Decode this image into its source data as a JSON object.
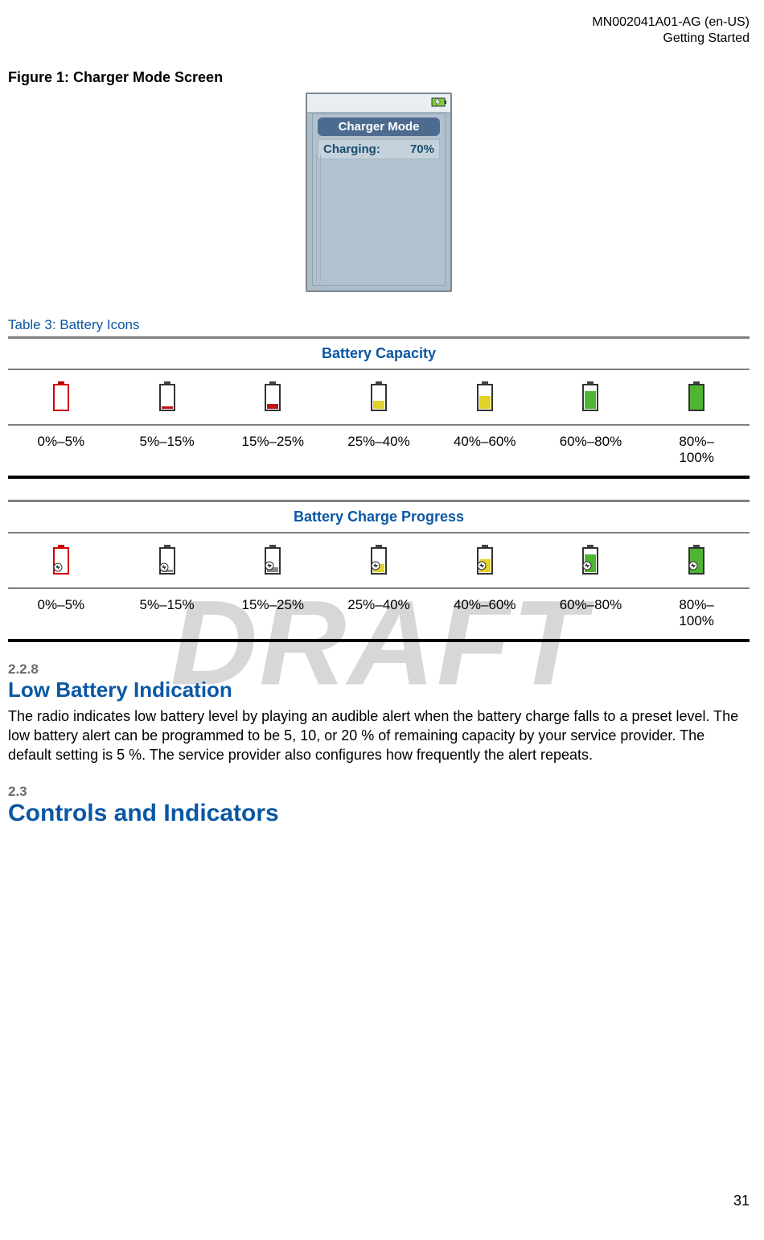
{
  "header": {
    "doc_id": "MN002041A01-AG (en-US)",
    "section": "Getting Started"
  },
  "figure": {
    "caption": "Figure 1: Charger Mode Screen",
    "phone_title": "Charger Mode",
    "phone_row_label": "Charging:",
    "phone_row_value": "70%"
  },
  "table3": {
    "caption": "Table 3: Battery Icons",
    "t1_title": "Battery Capacity",
    "t2_title": "Battery Charge Progress",
    "ranges": [
      "0%–5%",
      "5%–15%",
      "15%–25%",
      "25%–40%",
      "40%–60%",
      "60%–80%",
      "80%–\n100%"
    ]
  },
  "sec228": {
    "num": "2.2.8",
    "title": "Low Battery Indication",
    "body": "The radio indicates low battery level by playing an audible alert when the battery charge falls to a preset level. The low battery alert can be programmed to be 5, 10, or 20 % of remaining capacity by your service provider. The default setting is 5 %. The service provider also configures how frequently the alert repeats."
  },
  "sec23": {
    "num": "2.3",
    "title": "Controls and Indicators"
  },
  "watermark": "DRAFT",
  "page_number": "31",
  "chart_data": [
    {
      "type": "table",
      "title": "Battery Capacity",
      "categories": [
        "0%–5%",
        "5%–15%",
        "15%–25%",
        "25%–40%",
        "40%–60%",
        "60%–80%",
        "80%–100%"
      ],
      "series": [
        {
          "name": "fill_color",
          "values": [
            "none",
            "red",
            "red",
            "yellow",
            "yellow",
            "green",
            "green"
          ]
        },
        {
          "name": "fill_level_pct",
          "values": [
            0,
            10,
            20,
            30,
            50,
            70,
            95
          ]
        }
      ]
    },
    {
      "type": "table",
      "title": "Battery Charge Progress",
      "categories": [
        "0%–5%",
        "5%–15%",
        "15%–25%",
        "25%–40%",
        "40%–60%",
        "60%–80%",
        "80%–100%"
      ],
      "series": [
        {
          "name": "fill_color",
          "values": [
            "none",
            "gray",
            "gray",
            "yellow",
            "yellow",
            "green",
            "green"
          ]
        },
        {
          "name": "fill_level_pct",
          "values": [
            0,
            10,
            20,
            30,
            50,
            70,
            95
          ]
        },
        {
          "name": "charging_bolt",
          "values": [
            true,
            true,
            true,
            true,
            true,
            true,
            true
          ]
        }
      ]
    }
  ]
}
